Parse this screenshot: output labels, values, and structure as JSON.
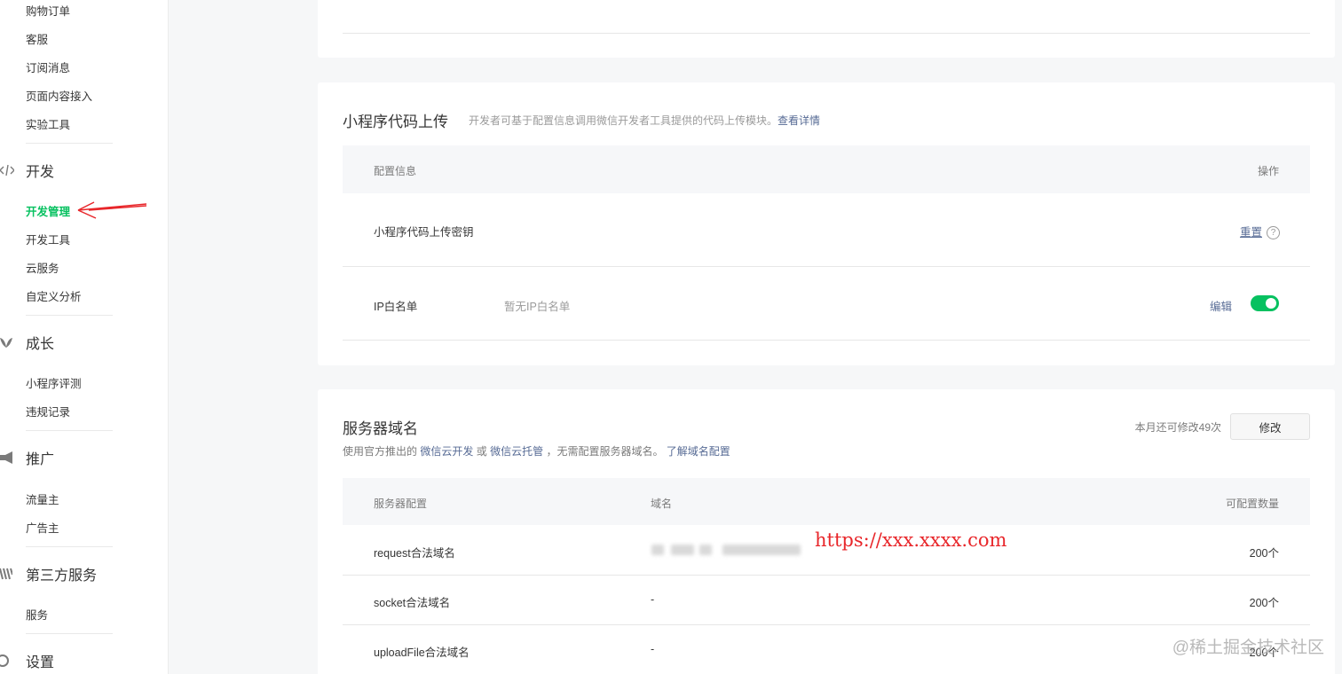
{
  "sidebar": {
    "top_items": [
      "购物订单",
      "客服",
      "订阅消息",
      "页面内容接入",
      "实验工具"
    ],
    "groups": {
      "dev": {
        "label": "开发",
        "icon": "code-icon",
        "items": [
          "开发管理",
          "开发工具",
          "云服务",
          "自定义分析"
        ],
        "active": "开发管理"
      },
      "growth": {
        "label": "成长",
        "icon": "leaf-icon",
        "items": [
          "小程序评测",
          "违规记录"
        ]
      },
      "promo": {
        "label": "推广",
        "icon": "megaphone-icon",
        "items": [
          "流量主",
          "广告主"
        ]
      },
      "third": {
        "label": "第三方服务",
        "icon": "third-party-icon",
        "items": [
          "服务"
        ]
      },
      "settings": {
        "label": "设置",
        "icon": "gear-icon"
      }
    }
  },
  "upload_section": {
    "title": "小程序代码上传",
    "desc": "开发者可基于配置信息调用微信开发者工具提供的代码上传模块。",
    "desc_link": "查看详情",
    "col_config": "配置信息",
    "col_action": "操作",
    "rows": [
      {
        "label": "小程序代码上传密钥",
        "action": "重置",
        "help": "?"
      },
      {
        "label": "IP白名单",
        "value": "暂无IP白名单",
        "action": "编辑",
        "toggle_on": true
      }
    ]
  },
  "server_section": {
    "title": "服务器域名",
    "desc_prefix": "使用官方推出的",
    "link_cloud_dev": "微信云开发",
    "desc_or": "或",
    "link_cloud_host": "微信云托管",
    "desc_mid": "，无需配置服务器域名。",
    "link_learn": "了解域名配置",
    "remaining": "本月还可修改49次",
    "modify_btn": "修改",
    "col_server": "服务器配置",
    "col_domain": "域名",
    "col_count": "可配置数量",
    "rows": [
      {
        "label": "request合法域名",
        "domain": "",
        "count": "200个"
      },
      {
        "label": "socket合法域名",
        "domain": "-",
        "count": "200个"
      },
      {
        "label": "uploadFile合法域名",
        "domain": "-",
        "count": "200个"
      }
    ]
  },
  "annotation": {
    "url": "https://xxx.xxxx.com",
    "arrow_color": "#e8262a"
  },
  "watermark": "@稀土掘金技术社区",
  "colors": {
    "accent": "#07c160",
    "link": "#576b95",
    "annotation": "#e8262a"
  }
}
